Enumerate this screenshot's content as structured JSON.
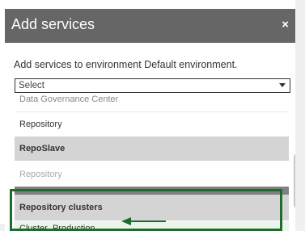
{
  "dialog": {
    "title": "Add services",
    "close_glyph": "×",
    "description": "Add services to environment Default environment.",
    "select": {
      "value": "Select"
    },
    "dropdown": {
      "partial_item": "Data Governance Center",
      "items": [
        {
          "label": "Repository"
        },
        {
          "group": "RepoSlave"
        },
        {
          "label": "Repository",
          "disabled": true
        },
        {
          "group": "Repository clusters"
        },
        {
          "label": "Cluster_Production",
          "highlighted": true
        }
      ]
    }
  },
  "colors": {
    "header": "#666666",
    "highlight_box": "#1e6b2f",
    "arrow": "#1e6b2f",
    "highlight_row": "#e9f5e8"
  },
  "icons": {
    "close": "close-icon",
    "caret": "caret-down-icon",
    "arrow": "arrow-left-icon"
  }
}
